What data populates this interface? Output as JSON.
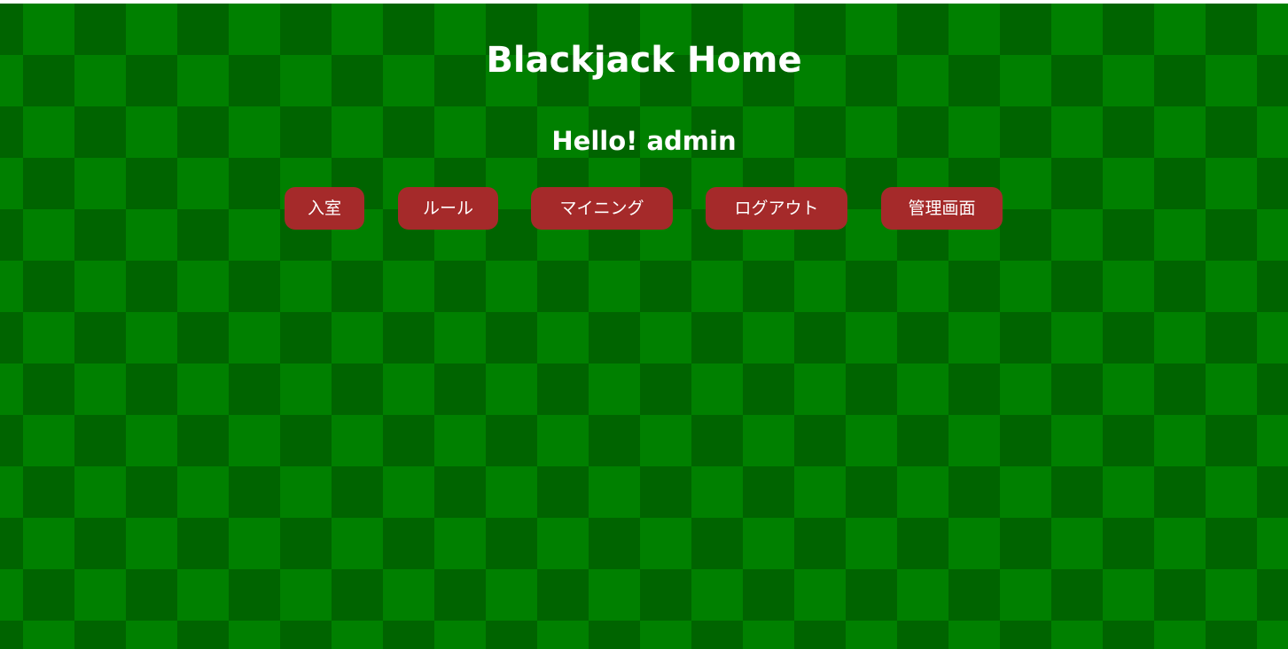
{
  "page": {
    "title": "Blackjack Home",
    "greeting": "Hello! admin"
  },
  "nav": {
    "buttons": [
      {
        "label": "入室"
      },
      {
        "label": "ルール"
      },
      {
        "label": "マイニング"
      },
      {
        "label": "ログアウト"
      },
      {
        "label": "管理画面"
      }
    ]
  },
  "colors": {
    "background_light": "#008000",
    "background_dark": "#006400",
    "button": "#a52a2a",
    "text": "#ffffff"
  }
}
